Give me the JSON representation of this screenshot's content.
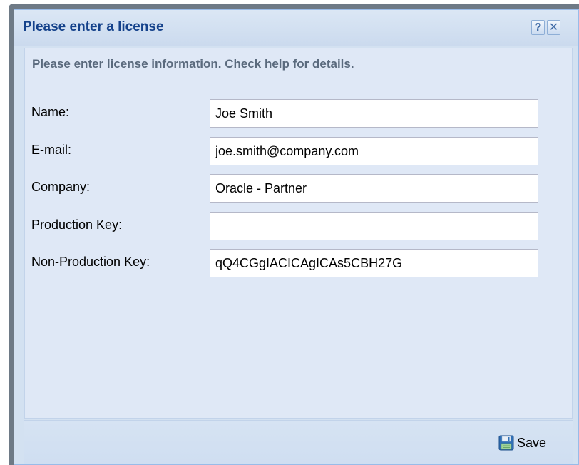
{
  "dialog": {
    "title": "Please enter a license",
    "help_glyph": "?",
    "close_glyph": "✕"
  },
  "form": {
    "instructions": "Please enter license information. Check help for details.",
    "fields": [
      {
        "label": "Name:",
        "value": "Joe Smith"
      },
      {
        "label": "E-mail:",
        "value": "joe.smith@company.com"
      },
      {
        "label": "Company:",
        "value": "Oracle - Partner"
      },
      {
        "label": "Production Key:",
        "value": ""
      },
      {
        "label": "Non-Production Key:",
        "value": "qQ4CGgIACICAgICAs5CBH27G"
      }
    ]
  },
  "footer": {
    "save_label": "Save",
    "save_icon": "floppy-disk-icon"
  },
  "colors": {
    "title_text": "#15428b",
    "window_background": "#dfe8f6",
    "frame_border": "#99bbe8"
  }
}
